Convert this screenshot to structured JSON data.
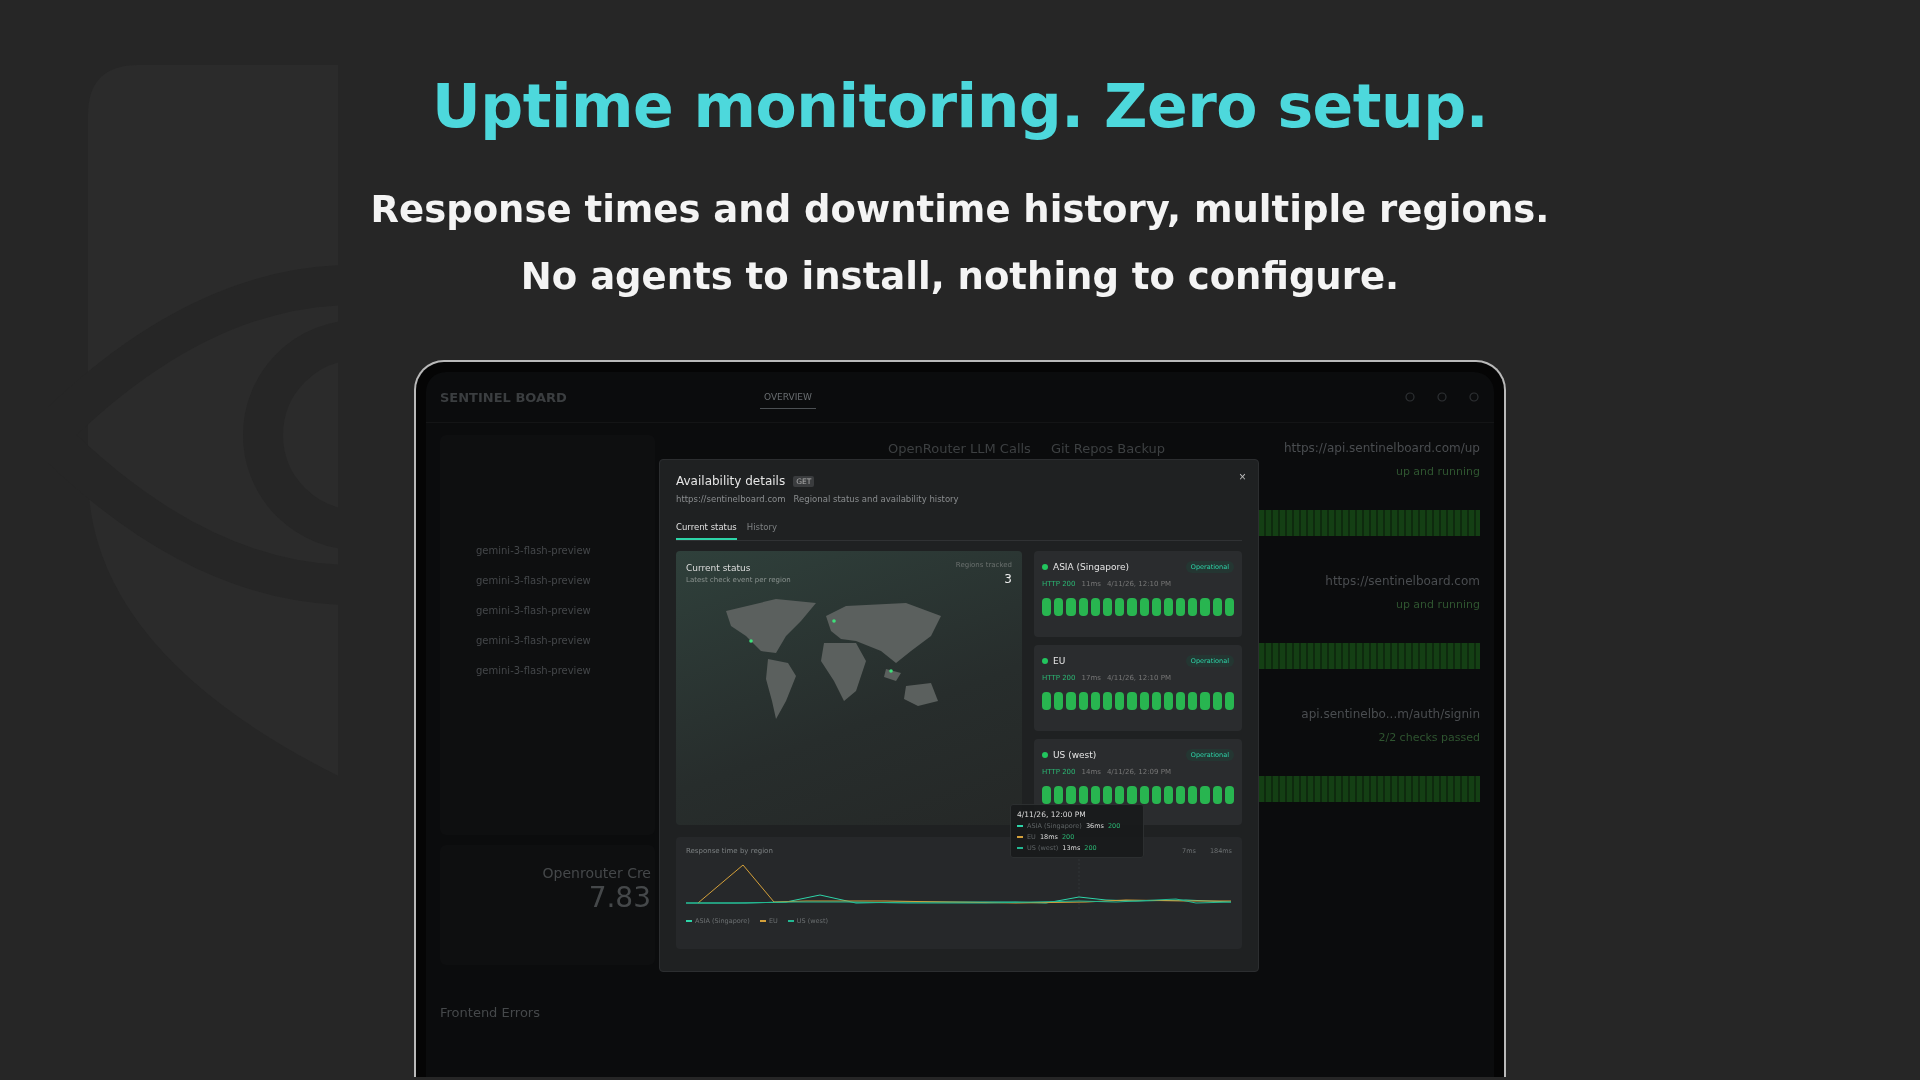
{
  "headline": "Uptime monitoring. Zero setup.",
  "subheadlines": [
    "Response times and downtime history, multiple regions.",
    "No agents to install, nothing to configure."
  ],
  "app": {
    "brand": "SENTINEL BOARD",
    "nav": [
      {
        "label": "OVERVIEW",
        "selected": true
      }
    ],
    "cards": [
      "OpenRouter LLM Calls",
      "Git Repos Backup"
    ],
    "calls": [
      "gemini-3-flash-preview",
      "gemini-3-flash-preview",
      "gemini-3-flash-preview",
      "gemini-3-flash-preview",
      "gemini-3-flash-preview"
    ],
    "credits": {
      "title": "Openrouter Cre",
      "value": "7.83"
    },
    "errors_title": "Frontend Errors",
    "monitors": [
      {
        "url": "https://api.sentinelboard.com/up",
        "status": "up and running"
      },
      {
        "url": "https://sentinelboard.com",
        "status": "up and running"
      },
      {
        "url": "api.sentinelbo...m/auth/signin",
        "status": "2/2 checks passed"
      }
    ]
  },
  "modal": {
    "close": "×",
    "title": "Availability details",
    "method": "GET",
    "url": "https://sentinelboard.com",
    "subtitle": "Regional status and availability history",
    "tabs": [
      {
        "label": "Current status",
        "selected": true
      },
      {
        "label": "History",
        "selected": false
      }
    ],
    "map_panel": {
      "title": "Current status",
      "caption": "Latest check event per region",
      "counter_label": "Regions tracked",
      "counter": "3"
    },
    "regions": [
      {
        "name": "ASIA (Singapore)",
        "color": "#22c55e",
        "badge": "Operational",
        "code": "HTTP 200",
        "latency": "11ms",
        "time": "4/11/26, 12:10 PM",
        "checks": [
          {
            "up": true
          },
          {
            "up": true
          },
          {
            "up": true
          },
          {
            "up": true
          },
          {
            "up": true
          },
          {
            "up": true
          },
          {
            "up": true
          },
          {
            "up": true
          },
          {
            "up": true
          },
          {
            "up": true
          },
          {
            "up": true
          },
          {
            "up": true
          },
          {
            "up": true
          },
          {
            "up": true
          },
          {
            "up": true
          },
          {
            "up": true
          }
        ]
      },
      {
        "name": "EU",
        "color": "#22c55e",
        "badge": "Operational",
        "code": "HTTP 200",
        "latency": "17ms",
        "time": "4/11/26, 12:10 PM",
        "checks": [
          {
            "up": true
          },
          {
            "up": true
          },
          {
            "up": true
          },
          {
            "up": true
          },
          {
            "up": true
          },
          {
            "up": true
          },
          {
            "up": true
          },
          {
            "up": true
          },
          {
            "up": true
          },
          {
            "up": true
          },
          {
            "up": true
          },
          {
            "up": true
          },
          {
            "up": true
          },
          {
            "up": true
          },
          {
            "up": true
          },
          {
            "up": true
          }
        ]
      },
      {
        "name": "US (west)",
        "color": "#22c55e",
        "badge": "Operational",
        "code": "HTTP 200",
        "latency": "14ms",
        "time": "4/11/26, 12:09 PM",
        "checks": [
          {
            "up": true
          },
          {
            "up": true
          },
          {
            "up": true
          },
          {
            "up": true
          },
          {
            "up": true
          },
          {
            "up": true
          },
          {
            "up": true
          },
          {
            "up": true
          },
          {
            "up": true
          },
          {
            "up": true
          },
          {
            "up": true
          },
          {
            "up": true
          },
          {
            "up": true
          },
          {
            "up": true
          },
          {
            "up": true
          },
          {
            "up": true
          }
        ]
      }
    ],
    "chart": {
      "title": "Response time by region",
      "min": "7ms",
      "max": "184ms",
      "legend": [
        {
          "name": "ASIA (Singapore)",
          "color": "#2dd4a8"
        },
        {
          "name": "EU",
          "color": "#d4a03a"
        },
        {
          "name": "US (west)",
          "color": "#22b892"
        }
      ]
    },
    "tooltip": {
      "time": "4/11/26, 12:00 PM",
      "rows": [
        {
          "name": "ASIA (Singapore)",
          "color": "#2dd4a8",
          "latency": "36ms",
          "code": "200"
        },
        {
          "name": "EU",
          "color": "#d4a03a",
          "latency": "18ms",
          "code": "200"
        },
        {
          "name": "US (west)",
          "color": "#22b892",
          "latency": "13ms",
          "code": "200"
        }
      ]
    }
  }
}
